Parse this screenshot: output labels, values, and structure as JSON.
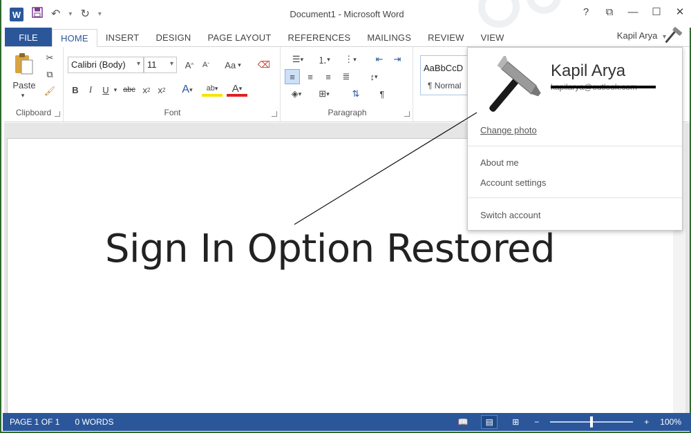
{
  "window": {
    "title": "Document1 - Microsoft Word",
    "app_logo": "W",
    "qat_icons": [
      "word-logo-icon",
      "save-icon",
      "undo-icon",
      "redo-icon",
      "customize-qat-icon"
    ],
    "controls": {
      "help": "?",
      "ribbon_display": "⧉",
      "minimize": "—",
      "maximize": "☐",
      "close": "✕"
    }
  },
  "tabs": {
    "file": "FILE",
    "items": [
      "HOME",
      "INSERT",
      "DESIGN",
      "PAGE LAYOUT",
      "REFERENCES",
      "MAILINGS",
      "REVIEW",
      "VIEW"
    ],
    "active": "HOME"
  },
  "user": {
    "name": "Kapil Arya",
    "arrow": "▾"
  },
  "ribbon": {
    "clipboard": {
      "label": "Clipboard",
      "paste": "Paste"
    },
    "font": {
      "label": "Font",
      "font_name": "Calibri (Body)",
      "font_size": "11",
      "change_case": "Aa"
    },
    "paragraph": {
      "label": "Paragraph"
    },
    "styles": {
      "preview": "AaBbCcD",
      "normal": "¶ Normal"
    }
  },
  "document": {
    "body_text": "Sign In Option Restored"
  },
  "status": {
    "page": "PAGE 1 OF 1",
    "words": "0 WORDS",
    "zoom": "100%",
    "zoom_minus": "−",
    "zoom_plus": "+"
  },
  "account_popup": {
    "name": "Kapil Arya",
    "email": "kapilarya@outlook.com",
    "change_photo": "Change photo",
    "about_me": "About me",
    "account_settings": "Account settings",
    "switch_account": "Switch account"
  },
  "colors": {
    "word_blue": "#2b579a",
    "frame_green": "#3d9a3d"
  }
}
